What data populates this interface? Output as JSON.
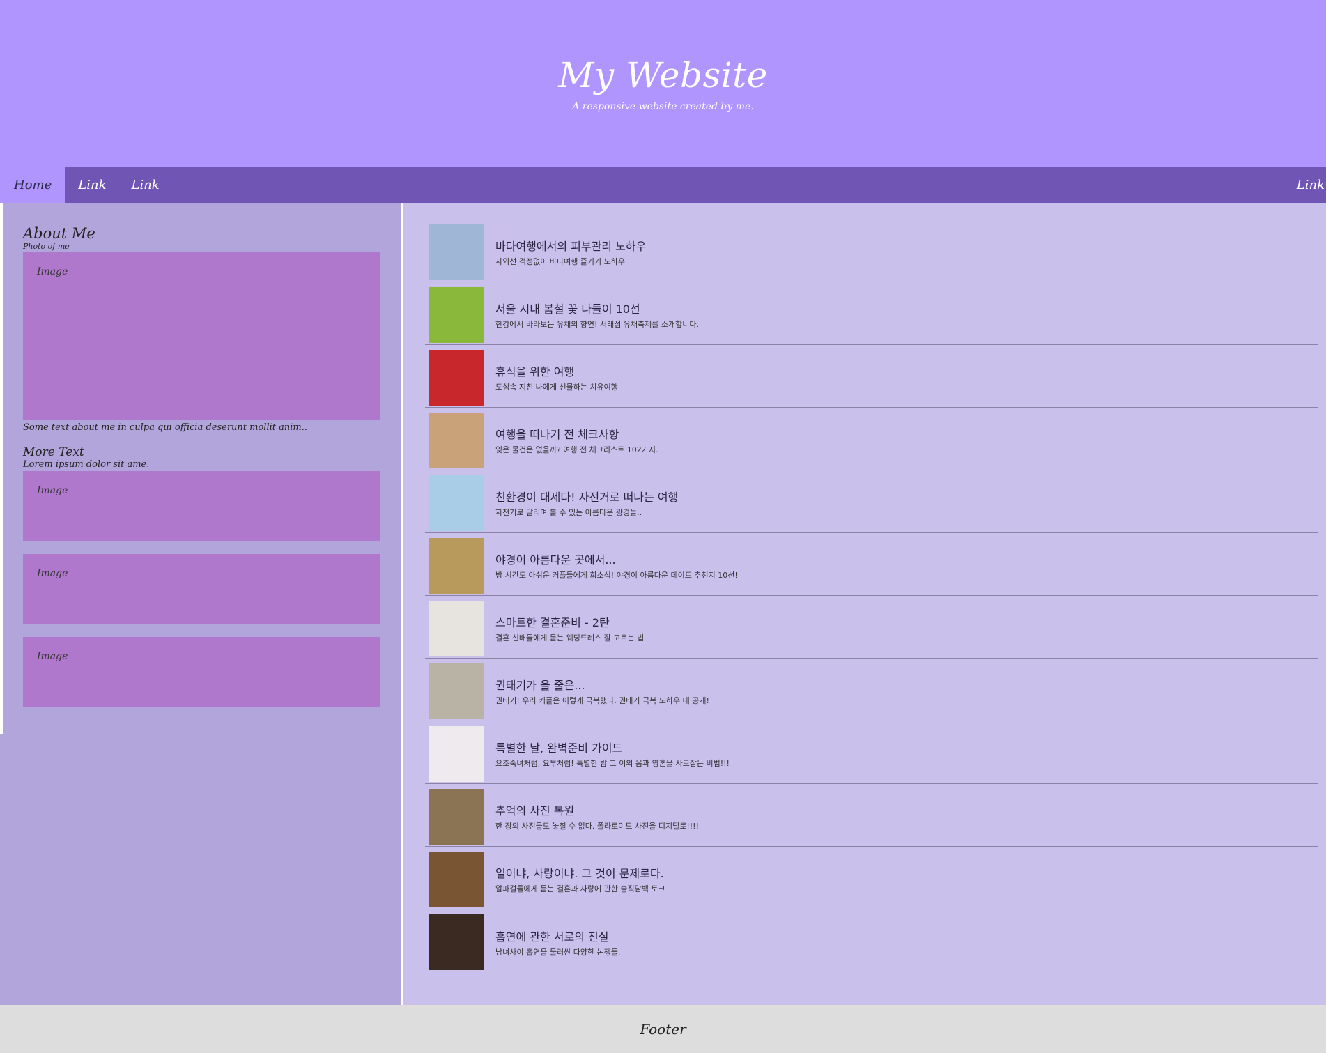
{
  "header": {
    "title": "My Website",
    "tagline": "A responsive website created by me."
  },
  "nav": {
    "home": "Home",
    "link1": "Link",
    "link2": "Link",
    "link_right": "Link"
  },
  "side": {
    "about_title": "About Me",
    "photo_caption": "Photo of me",
    "image_label": "Image",
    "about_text": "Some text about me in culpa qui officia deserunt mollit anim..",
    "more_title": "More Text",
    "more_text": "Lorem ipsum dolor sit ame."
  },
  "articles": [
    {
      "title": "바다여행에서의 피부관리 노하우",
      "desc": "자외선 걱정없이 바다여행 즐기기 노하우",
      "thumb": "#9fb6d6"
    },
    {
      "title": "서울 시내 봄철 꽃 나들이 10선",
      "desc": "한강에서 바라보는 유채의 향연! 서래섬 유채축제를 소개합니다.",
      "thumb": "#8ab83a"
    },
    {
      "title": "휴식을 위한 여행",
      "desc": "도심속 지친 나에게 선물하는 치유여행",
      "thumb": "#c8282c"
    },
    {
      "title": "여행을 떠나기 전 체크사항",
      "desc": "잊은 물건은 없을까? 여행 전 체크리스트 102가지.",
      "thumb": "#c9a27a"
    },
    {
      "title": "친환경이 대세다! 자전거로 떠나는 여행",
      "desc": "자전거로 달리며 볼 수 있는 아름다운 광경들..",
      "thumb": "#a9cde6"
    },
    {
      "title": "야경이 아름다운 곳에서...",
      "desc": "밤 시간도 아쉬운 커플들에게 희소식! 야경이 아름다운 데이트 추천지 10선!",
      "thumb": "#b89a5c"
    },
    {
      "title": "스마트한 결혼준비 - 2탄",
      "desc": "결혼 선배들에게 듣는 웨딩드레스 잘 고르는 법",
      "thumb": "#e7e4df"
    },
    {
      "title": "권태기가 올 줄은...",
      "desc": "권태기! 우리 커플은 이렇게 극복했다. 권태기 극복 노하우 대 공개!",
      "thumb": "#b9b3a5"
    },
    {
      "title": "특별한 날, 완벽준비 가이드",
      "desc": "요조숙녀처럼, 요부처럼! 특별한 밤 그 이의 몸과 영혼을 사로잡는 비법!!!",
      "thumb": "#efeaed"
    },
    {
      "title": "추억의 사진 복원",
      "desc": "한 장의 사진들도 놓칠 수 없다. 폴라로이드 사진을 디지털로!!!!",
      "thumb": "#8a7454"
    },
    {
      "title": "일이냐, 사랑이냐. 그 것이 문제로다.",
      "desc": "알파걸들에게 듣는 결혼과 사랑에 관한 솔직담백 토크",
      "thumb": "#7a5533"
    },
    {
      "title": "흡연에 관한 서로의 진실",
      "desc": "남녀사이 흡연을 둘러싼 다양한 논쟁들.",
      "thumb": "#3a2a22"
    }
  ],
  "footer": {
    "text": "Footer"
  }
}
